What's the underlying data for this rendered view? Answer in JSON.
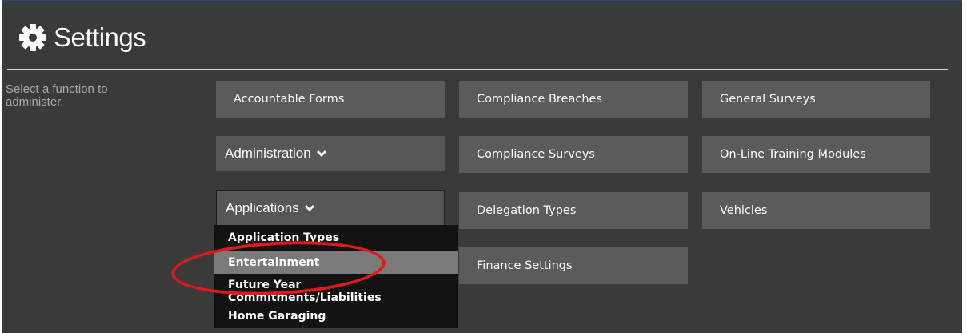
{
  "header": {
    "title": "Settings",
    "icon": "gear-icon"
  },
  "hint": "Select a function to administer.",
  "tiles": {
    "accountable_forms": "Accountable Forms",
    "compliance_breaches": "Compliance Breaches",
    "general_surveys": "General Surveys",
    "administration": "Administration",
    "compliance_surveys": "Compliance Surveys",
    "online_training": "On-Line Training Modules",
    "applications": "Applications",
    "delegation_types": "Delegation Types",
    "vehicles": "Vehicles",
    "finance_settings": "Finance Settings"
  },
  "applications_menu": {
    "items": [
      "Application Types",
      "Entertainment",
      "Future Year Commitments/Liabilities",
      "Home Garaging"
    ],
    "highlighted": "Entertainment"
  },
  "colors": {
    "panel": "#3a3a3a",
    "tile": "#5b5b5b",
    "menu": "#121212",
    "highlight": "#7a7a7a",
    "annotation": "#e3181b"
  }
}
